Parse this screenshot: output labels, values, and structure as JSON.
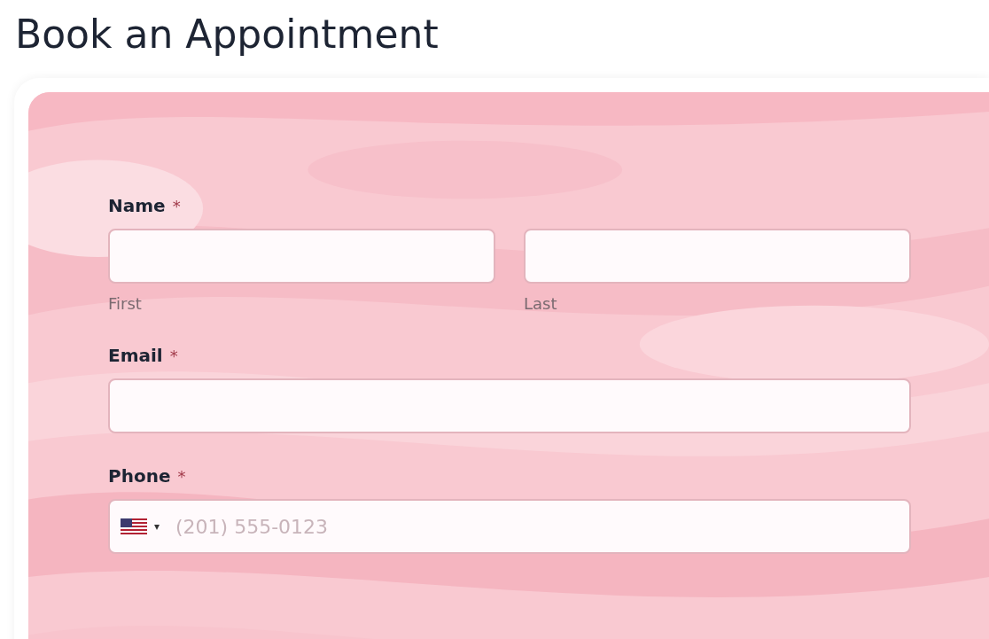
{
  "title": "Book an Appointment",
  "form": {
    "fields": [
      {
        "kind": "name",
        "label": "Name",
        "required_mark": "*",
        "sublabels": [
          "First",
          "Last"
        ]
      },
      {
        "kind": "email",
        "label": "Email",
        "required_mark": "*"
      },
      {
        "kind": "phone",
        "label": "Phone",
        "required_mark": "*",
        "placeholder": "(201) 555-0123",
        "country_caret": "▾"
      }
    ]
  }
}
